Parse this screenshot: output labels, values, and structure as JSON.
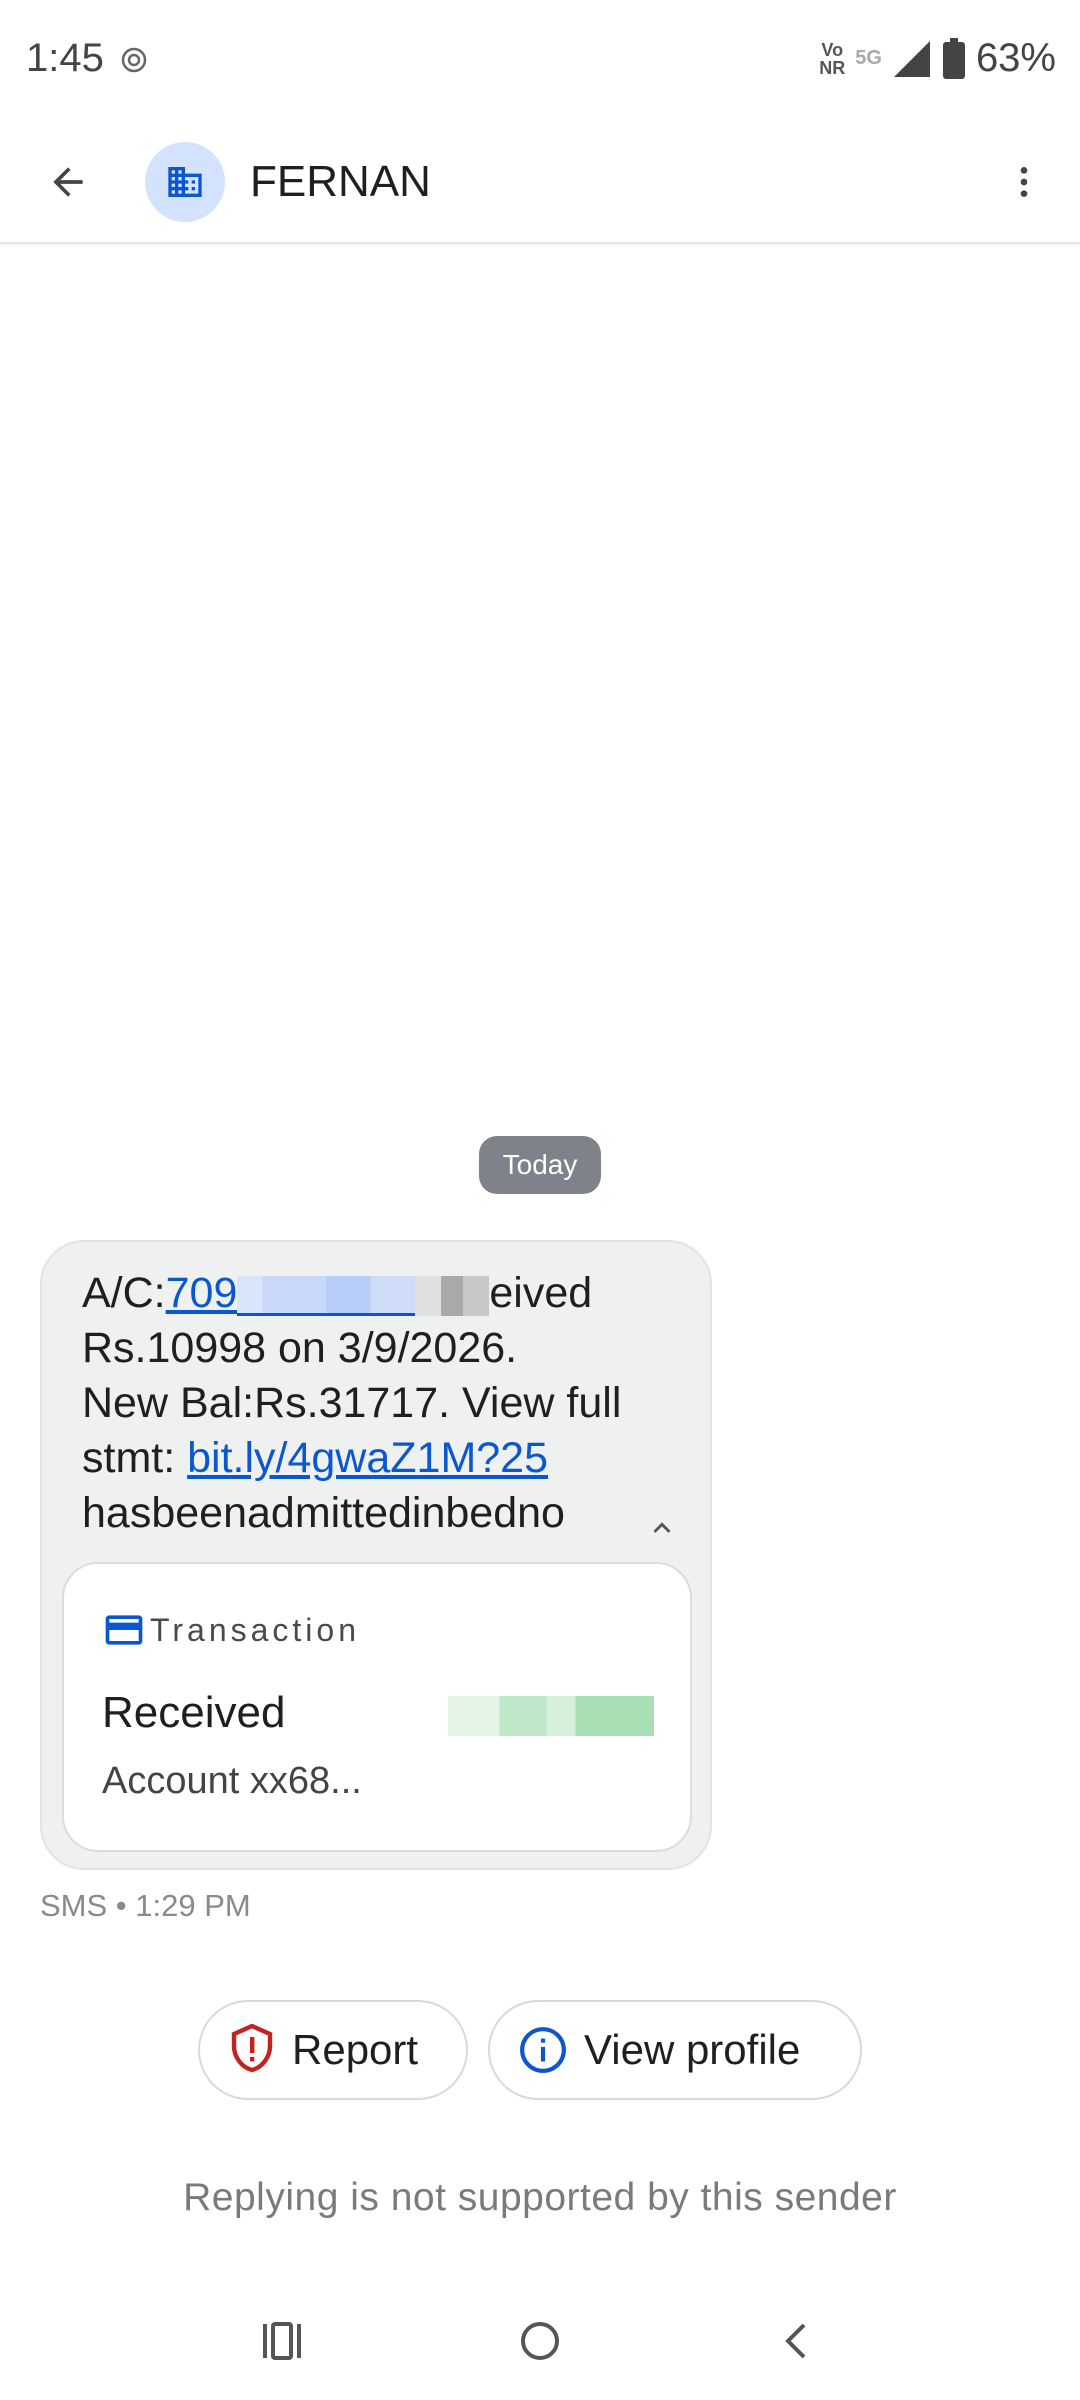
{
  "status_bar": {
    "time": "1:45",
    "volte_line1": "Vo",
    "volte_line2": "NR",
    "network": "5G",
    "battery": "63%"
  },
  "app_bar": {
    "contact_name": "FERNAN",
    "avatar_icon": "building-icon",
    "back_icon": "arrow-back-icon",
    "menu_icon": "more-vert-icon"
  },
  "conversation": {
    "date_label": "Today",
    "message": {
      "line1_prefix": "A/C:",
      "line1_link": "709",
      "line1_suffix": "eived",
      "line2": "Rs.10998 on 3/9/2026.",
      "line3": "New Bal:Rs.31717. View full",
      "line4_prefix": "stmt: ",
      "line4_link": "bit.ly/4gwaZ1M?25",
      "line5": "hasbeenadmittedinbedno"
    },
    "transaction_card": {
      "title": "Transaction",
      "status": "Received",
      "account": "Account xx68..."
    },
    "meta": "SMS • 1:29 PM"
  },
  "actions": {
    "report_label": "Report",
    "view_profile_label": "View profile"
  },
  "footer_note": "Replying is not supported by this sender",
  "colors": {
    "accent": "#0b57d0",
    "report_red": "#c5221f",
    "avatar_bg": "#d3e3fd",
    "bubble_bg": "#eff1f1",
    "date_chip_bg": "#7d8389"
  }
}
